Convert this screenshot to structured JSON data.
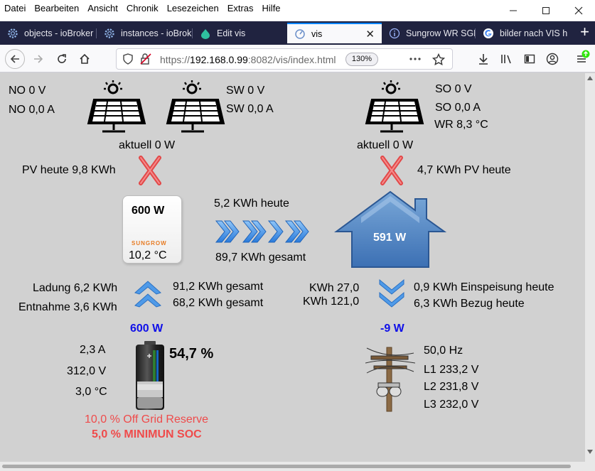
{
  "menu": [
    "Datei",
    "Bearbeiten",
    "Ansicht",
    "Chronik",
    "Lesezeichen",
    "Extras",
    "Hilfe"
  ],
  "tabs": [
    {
      "label": "objects - ioBroker"
    },
    {
      "label": "instances - ioBrok"
    },
    {
      "label": "Edit vis"
    },
    {
      "label": "vis"
    },
    {
      "label": "Sungrow WR SGH"
    },
    {
      "label": "bilder nach VIS h"
    }
  ],
  "url": {
    "prefix": "https://",
    "host": "192.168.0.99",
    "rest": ":8082/vis/index.html",
    "zoom": "130%"
  },
  "colors": {
    "accent": "#0a84ff",
    "tabbar": "#202340",
    "power_blue": "#1010e8",
    "warn_red": "#ef4b4b",
    "arrow_blue": "#3d8fe6"
  },
  "pv": {
    "no_voltage": "NO 0 V",
    "no_current": "NO 0,0 A",
    "sw_voltage": "SW 0 V",
    "sw_current": "SW 0,0 A",
    "so_voltage": "SO 0 V",
    "so_current": "SO 0,0 A",
    "wr_temp": "WR 8,3 °C",
    "left_current": "aktuell 0 W",
    "right_current": "aktuell 0 W",
    "left_today": "PV heute 9,8 KWh",
    "right_today": "4,7 KWh PV heute"
  },
  "inverter": {
    "power": "600 W",
    "brand": "SUNGROW",
    "temp": "10,2 °C",
    "today": "5,2 KWh heute",
    "total": "89,7 KWh gesamt"
  },
  "house": {
    "power": "591 W"
  },
  "battery": {
    "charge_today": "Ladung 6,2 KWh",
    "discharge_today": "Entnahme 3,6 KWh",
    "charge_total": "91,2 KWh gesamt",
    "discharge_total": "68,2 KWh gesamt",
    "power": "600 W",
    "current": "2,3 A",
    "voltage": "312,0 V",
    "temp": "3,0 °C",
    "soc": "54,7 %",
    "soc_value": 54.7,
    "reserve": "10,0 % Off Grid Reserve",
    "min_soc": "5,0 % MINIMUN SOC"
  },
  "grid": {
    "feed_total": "KWh 27,0",
    "draw_total": "KWh 121,0",
    "feed_today": "0,9 KWh Einspeisung heute",
    "draw_today": "6,3 KWh Bezug heute",
    "power": "-9 W",
    "freq": "50,0 Hz",
    "l1": "L1 233,2 V",
    "l2": "L2 231,8 V",
    "l3": "L3 232,0 V"
  }
}
